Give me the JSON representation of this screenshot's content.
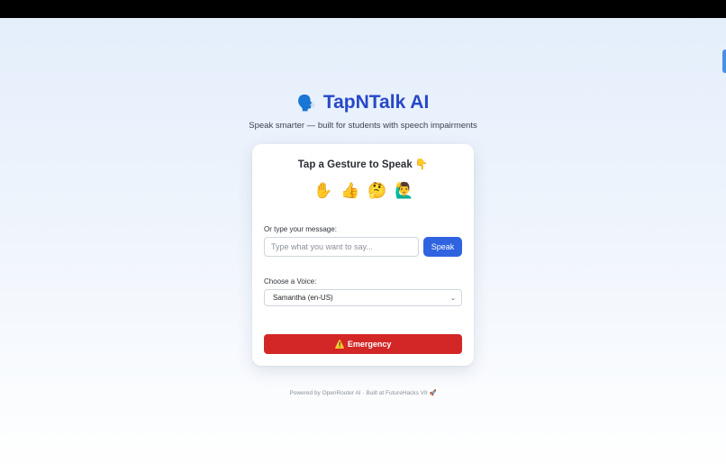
{
  "header": {
    "icon": "speaking-head-icon",
    "icon_glyph": "🗣️",
    "title": "TapNTalk AI",
    "subtitle": "Speak smarter — built for students with speech impairments"
  },
  "card": {
    "title": "Tap a Gesture to Speak 👇",
    "gestures": [
      {
        "name": "raised-hand-icon",
        "glyph": "✋"
      },
      {
        "name": "thumbs-up-icon",
        "glyph": "👍"
      },
      {
        "name": "thinking-face-icon",
        "glyph": "🤔"
      },
      {
        "name": "person-raising-hand-icon",
        "glyph": "🙋‍♂️"
      }
    ],
    "message_label": "Or type your message:",
    "message_placeholder": "Type what you want to say...",
    "speak_label": "Speak",
    "voice_label": "Choose a Voice:",
    "voice_selected": "Samantha (en-US)",
    "emergency_icon": "⚠️",
    "emergency_label": "Emergency"
  },
  "footer": "Powered by OpenRouter AI · Built at FutureHacks VII 🚀",
  "colors": {
    "title": "#2748c9",
    "speak_button": "#2f63e0",
    "emergency_button": "#d32626",
    "side_tab": "#4a90e2"
  }
}
